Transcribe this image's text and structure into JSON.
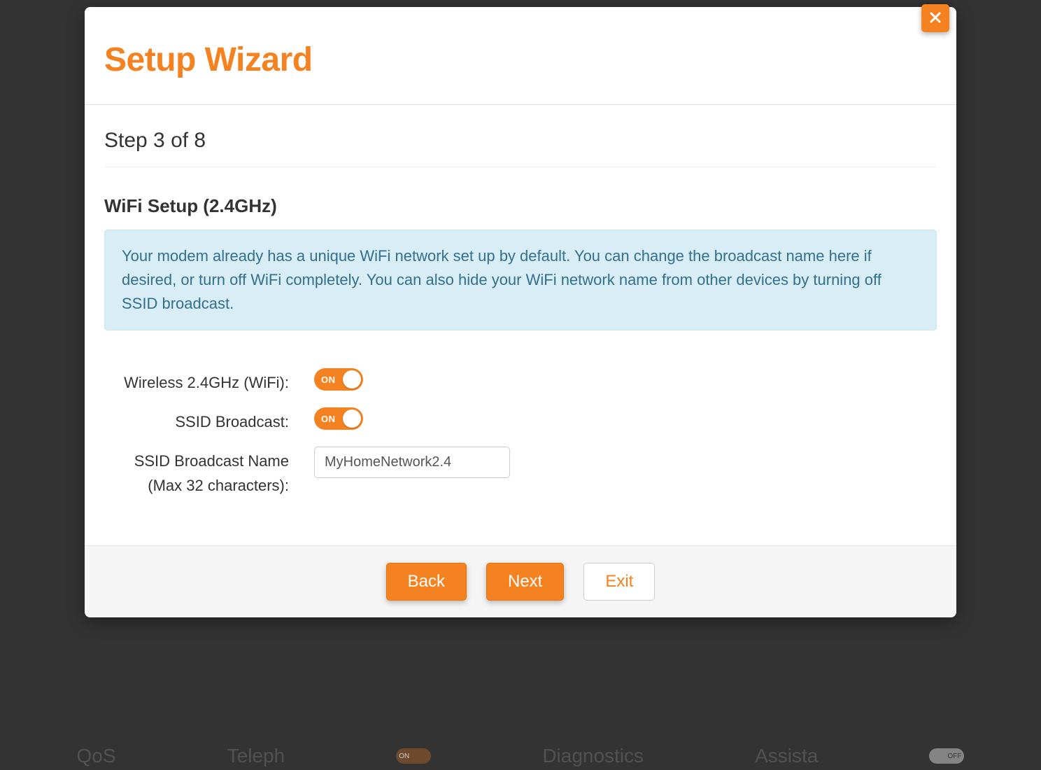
{
  "modal": {
    "title": "Setup Wizard",
    "step_heading": "Step 3 of 8",
    "section_heading": "WiFi Setup (2.4GHz)",
    "info_text": "Your modem already has a unique WiFi network set up by default. You can change the broadcast name here if desired, or turn off WiFi completely. You can also hide your WiFi network name from other devices by turning off SSID broadcast."
  },
  "form": {
    "wireless_label": "Wireless 2.4GHz (WiFi):",
    "wireless_state": "ON",
    "ssid_broadcast_label": "SSID Broadcast:",
    "ssid_broadcast_state": "ON",
    "ssid_name_label_line1": "SSID Broadcast Name",
    "ssid_name_label_line2": "(Max 32 characters):",
    "ssid_name_value": "MyHomeNetwork2.4"
  },
  "footer": {
    "back": "Back",
    "next": "Next",
    "exit": "Exit"
  },
  "background_nav": {
    "item1": "QoS",
    "item2": "Teleph",
    "item3": "Diagnostics",
    "item4": "Assista",
    "on": "ON",
    "off": "OFF"
  },
  "colors": {
    "accent": "#f58220",
    "info_bg": "#d9edf7",
    "info_border": "#bce8f1",
    "info_text": "#31708f"
  }
}
